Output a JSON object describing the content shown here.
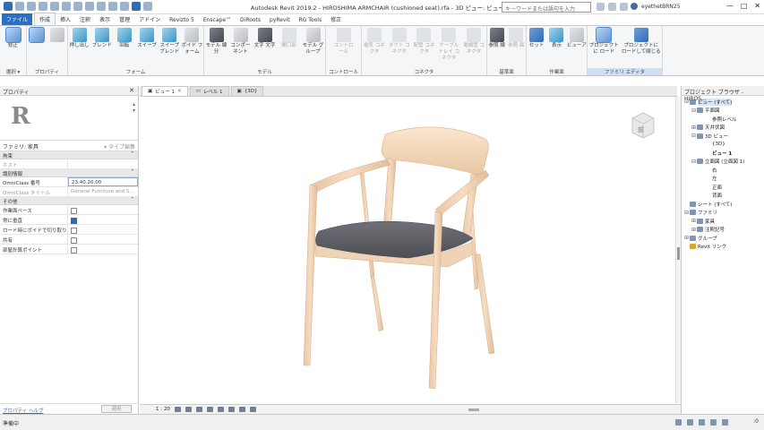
{
  "title_bar": {
    "title": "Autodesk Revit 2019.2 - HIROSHIMA ARMCHAIR (cushioned seat).rfa - 3D ビュー: ビュー 1",
    "search_placeholder": "キーワードまたは語句を入力",
    "user": "eyethetBRN25",
    "minimize": "—",
    "maximize": "□",
    "close": "✕"
  },
  "tabs": [
    "ファイル",
    "作成",
    "挿入",
    "注釈",
    "表示",
    "管理",
    "アドイン",
    "Revizto 5",
    "Enscape™",
    "DiRoots",
    "pyRevit",
    "RG Tools",
    "修正"
  ],
  "ribbon": {
    "groups": [
      {
        "label": "選択 ▾",
        "tools": [
          {
            "label": "修正",
            "icon": "modify-arrow-icon",
            "selected": true
          }
        ]
      },
      {
        "label": "プロパティ",
        "tools": [
          {
            "label": "",
            "icon": "family-types-icon"
          },
          {
            "label": "",
            "icon": "family-category-icon"
          }
        ]
      },
      {
        "label": "フォーム",
        "tools": [
          {
            "label": "押し出し",
            "icon": "extrusion-icon"
          },
          {
            "label": "ブレンド",
            "icon": "blend-icon"
          },
          {
            "label": "回転",
            "icon": "revolve-icon"
          },
          {
            "label": "スイープ",
            "icon": "sweep-icon"
          },
          {
            "label": "スイープ ブレンド",
            "icon": "swept-blend-icon"
          },
          {
            "label": "ボイド フォーム",
            "icon": "void-form-icon"
          }
        ]
      },
      {
        "label": "モデル",
        "tools": [
          {
            "label": "モデル 線分",
            "icon": "model-line-icon"
          },
          {
            "label": "コンポーネント",
            "icon": "component-icon"
          },
          {
            "label": "文字 文字",
            "icon": "model-text-icon"
          },
          {
            "label": "開口部",
            "icon": "opening-icon",
            "dim": true
          },
          {
            "label": "モデル グループ",
            "icon": "model-group-icon"
          }
        ]
      },
      {
        "label": "コントロール",
        "tools": [
          {
            "label": "コントロール",
            "icon": "control-icon",
            "dim": true
          }
        ]
      },
      {
        "label": "コネクタ",
        "tools": [
          {
            "label": "電気 コネクタ",
            "icon": "electrical-connector-icon",
            "dim": true
          },
          {
            "label": "ダクト コネクタ",
            "icon": "duct-connector-icon",
            "dim": true
          },
          {
            "label": "配管 コネクタ",
            "icon": "pipe-connector-icon",
            "dim": true
          },
          {
            "label": "ケーブル トレイ コネクタ",
            "icon": "cable-tray-connector-icon",
            "dim": true
          },
          {
            "label": "電線管 コネクタ",
            "icon": "conduit-connector-icon",
            "dim": true
          }
        ]
      },
      {
        "label": "基準面",
        "tools": [
          {
            "label": "参照 線",
            "icon": "reference-line-icon"
          },
          {
            "label": "参照 面",
            "icon": "reference-plane-icon",
            "dim": true
          }
        ]
      },
      {
        "label": "作業面",
        "tools": [
          {
            "label": "セット",
            "icon": "set-workplane-icon"
          },
          {
            "label": "表示",
            "icon": "show-workplane-icon"
          },
          {
            "label": "ビューア",
            "icon": "viewer-icon"
          }
        ]
      },
      {
        "label": "ファミリ エディタ",
        "tools": [
          {
            "label": "プロジェクトに ロード",
            "icon": "load-into-project-icon",
            "selected": true
          },
          {
            "label": "プロジェクトに ロードして閉じる",
            "icon": "load-and-close-icon"
          }
        ]
      }
    ]
  },
  "properties": {
    "title": "プロパティ",
    "close": "✕",
    "family_label": "ファミリ: 家具",
    "edit_type": "タイプ編集",
    "sections": [
      {
        "name": "拘束",
        "rows": [
          {
            "key": "ホスト",
            "value": "",
            "dim": true
          }
        ]
      },
      {
        "name": "識別情報",
        "rows": [
          {
            "key": "OmniClass 番号",
            "value": "23.40.20.00",
            "input": true
          },
          {
            "key": "OmniClass タイトル",
            "value": "General Furniture and S...",
            "dim": true
          }
        ]
      },
      {
        "name": "その他",
        "rows": [
          {
            "key": "作業面ベース",
            "check": false
          },
          {
            "key": "常に垂直",
            "check": true
          },
          {
            "key": "ロード時にボイドで切り取り",
            "check": false
          },
          {
            "key": "共有",
            "check": false
          },
          {
            "key": "部屋計算ポイント",
            "check": false
          }
        ]
      }
    ],
    "help_link": "プロパティ ヘルプ",
    "apply": "適用"
  },
  "view_tabs": [
    {
      "label": "ビュー 1",
      "active": true
    },
    {
      "label": "レベル 1",
      "active": false
    },
    {
      "label": "{3D}",
      "active": false
    }
  ],
  "view_control": {
    "scale": "1 : 20"
  },
  "viewcube": {
    "face": "前"
  },
  "browser": {
    "title": "プロジェクト ブラウザ - HIROS...",
    "tree": [
      {
        "label": "ビュー (すべて)",
        "level": 0,
        "toggle": "⊟",
        "sel": true
      },
      {
        "label": "平面図",
        "level": 1,
        "toggle": "⊟"
      },
      {
        "label": "参照レベル",
        "level": 2,
        "toggle": ""
      },
      {
        "label": "天井伏図",
        "level": 1,
        "toggle": "⊞"
      },
      {
        "label": "3D ビュー",
        "level": 1,
        "toggle": "⊟"
      },
      {
        "label": "{3D}",
        "level": 2,
        "toggle": ""
      },
      {
        "label": "ビュー 1",
        "level": 2,
        "toggle": "",
        "bold": true
      },
      {
        "label": "立面図 (立面図 1)",
        "level": 1,
        "toggle": "⊟"
      },
      {
        "label": "右",
        "level": 2,
        "toggle": ""
      },
      {
        "label": "左",
        "level": 2,
        "toggle": ""
      },
      {
        "label": "正面",
        "level": 2,
        "toggle": ""
      },
      {
        "label": "背面",
        "level": 2,
        "toggle": ""
      },
      {
        "label": "シート (すべて)",
        "level": 0,
        "toggle": ""
      },
      {
        "label": "ファミリ",
        "level": 0,
        "toggle": "⊟"
      },
      {
        "label": "家具",
        "level": 1,
        "toggle": "⊞"
      },
      {
        "label": "注釈記号",
        "level": 1,
        "toggle": "⊞"
      },
      {
        "label": "グループ",
        "level": 0,
        "toggle": "⊞"
      },
      {
        "label": "Revit リンク",
        "level": 0,
        "toggle": "",
        "yellow": true
      }
    ]
  },
  "status": {
    "text": "準備中",
    "filter": ":0"
  },
  "colors": {
    "accent": "#2b6fc4",
    "wood": "#f0d2b4",
    "cushion": "#5f6068"
  }
}
